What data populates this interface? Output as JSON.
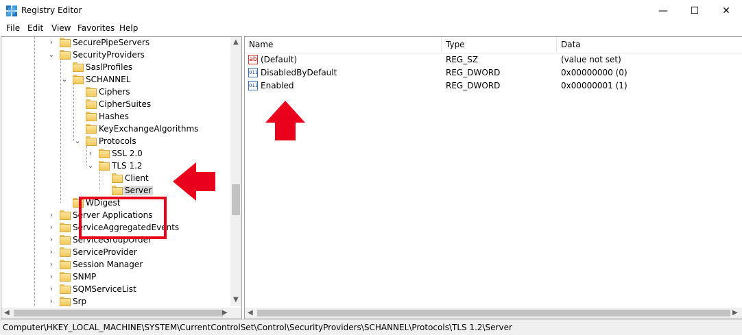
{
  "window": {
    "title": "Registry Editor",
    "minimize_glyph": "—",
    "maximize_glyph": "☐",
    "close_glyph": "✕",
    "icon": "registry-editor-icon"
  },
  "menu": [
    "File",
    "Edit",
    "View",
    "Favorites",
    "Help"
  ],
  "tree": {
    "nodes": [
      {
        "label": "SecurePipeServers",
        "expander": "›"
      },
      {
        "label": "SecurityProviders",
        "expander": "⌄"
      },
      {
        "label": "SaslProfiles",
        "expander": ""
      },
      {
        "label": "SCHANNEL",
        "expander": "⌄"
      },
      {
        "label": "Ciphers",
        "expander": ""
      },
      {
        "label": "CipherSuites",
        "expander": ""
      },
      {
        "label": "Hashes",
        "expander": ""
      },
      {
        "label": "KeyExchangeAlgorithms",
        "expander": ""
      },
      {
        "label": "Protocols",
        "expander": "⌄"
      },
      {
        "label": "SSL 2.0",
        "expander": "›"
      },
      {
        "label": "TLS 1.2",
        "expander": "⌄"
      },
      {
        "label": "Client",
        "expander": ""
      },
      {
        "label": "Server",
        "expander": "",
        "selected": true
      },
      {
        "label": "WDigest",
        "expander": ""
      },
      {
        "label": "Server Applications",
        "expander": "›"
      },
      {
        "label": "ServiceAggregatedEvents",
        "expander": "›"
      },
      {
        "label": "ServiceGroupOrder",
        "expander": "›"
      },
      {
        "label": "ServiceProvider",
        "expander": "›"
      },
      {
        "label": "Session Manager",
        "expander": "›"
      },
      {
        "label": "SNMP",
        "expander": "›"
      },
      {
        "label": "SQMServiceList",
        "expander": "›"
      },
      {
        "label": "Srp",
        "expander": "›"
      }
    ]
  },
  "list": {
    "headers": [
      "Name",
      "Type",
      "Data"
    ],
    "rows": [
      {
        "icon": "string-value-icon",
        "badge": "ab",
        "name": "(Default)",
        "type": "REG_SZ",
        "data": "(value not set)"
      },
      {
        "icon": "binary-value-icon",
        "badge": "011",
        "name": "DisabledByDefault",
        "type": "REG_DWORD",
        "data": "0x00000000 (0)"
      },
      {
        "icon": "binary-value-icon",
        "badge": "011",
        "name": "Enabled",
        "type": "REG_DWORD",
        "data": "0x00000001 (1)"
      }
    ]
  },
  "status": {
    "path": "Computer\\HKEY_LOCAL_MACHINE\\SYSTEM\\CurrentControlSet\\Control\\SecurityProviders\\SCHANNEL\\Protocols\\TLS 1.2\\Server"
  },
  "annotations": {
    "color": "#e8001c"
  }
}
